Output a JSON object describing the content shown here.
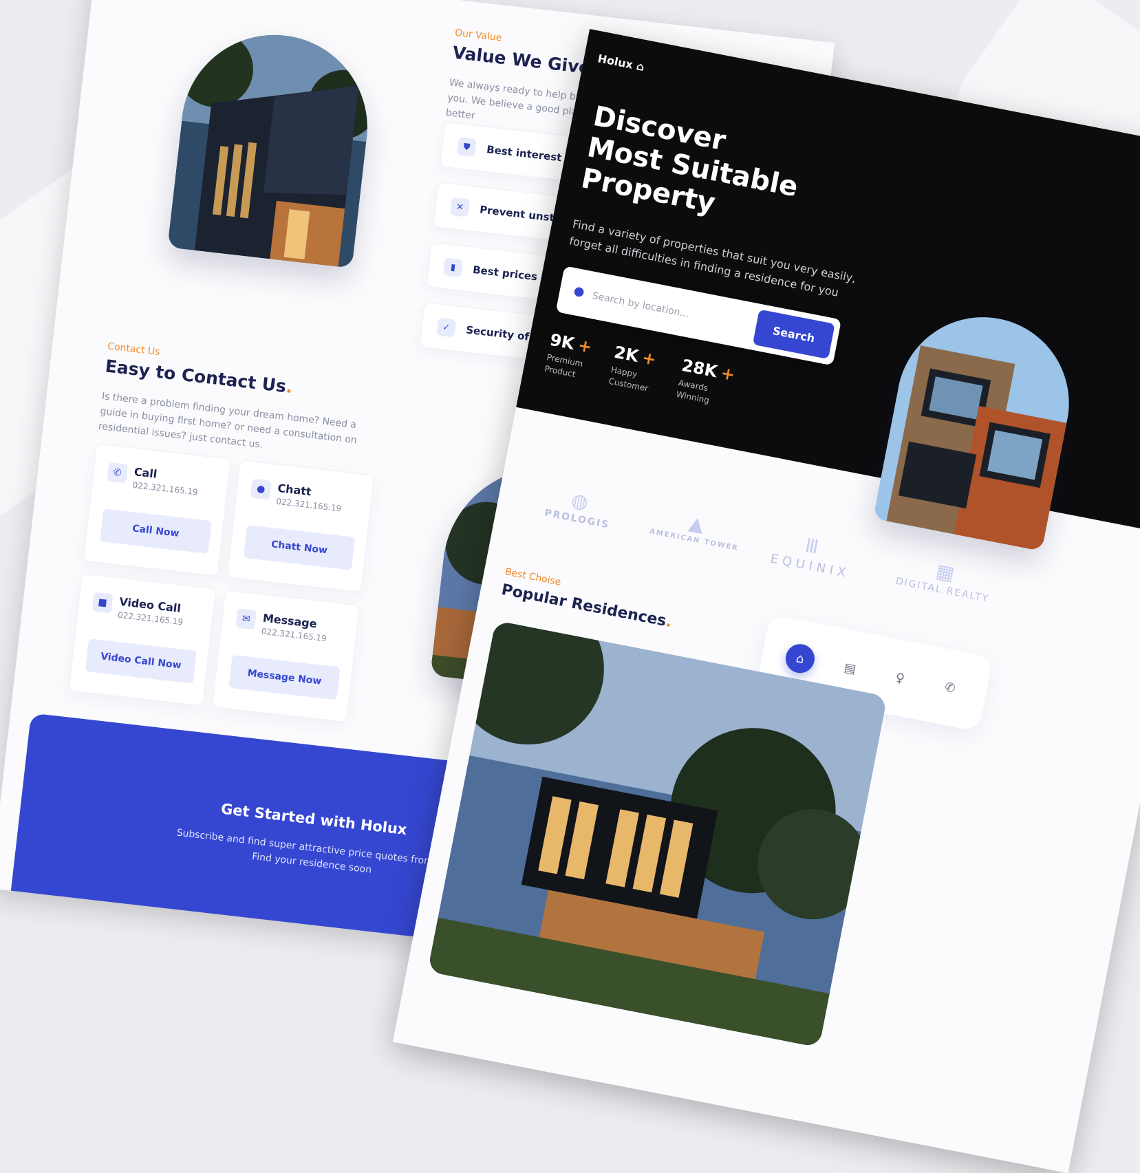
{
  "colors": {
    "accent": "#3547d1",
    "highlight": "#f08a2a",
    "dark": "#0c0c0d",
    "text": "#1c2350"
  },
  "value_section": {
    "eyebrow": "Our Value",
    "title": "Value We Give To You",
    "paragraph": "We always ready to help by providing the best service for you. We believe a good place to live can make your life better",
    "items": [
      {
        "icon": "shield-icon",
        "label": "Best interest rates on the market"
      },
      {
        "icon": "x-icon",
        "label": "Prevent unstable prices"
      },
      {
        "icon": "bar-chart-icon",
        "label": "Best prices on the market"
      },
      {
        "icon": "check-icon",
        "label": "Security of your data"
      }
    ]
  },
  "contact_section": {
    "eyebrow": "Contact Us",
    "title": "Easy to Contact Us",
    "title_dot": ".",
    "paragraph": "Is there a problem finding your dream home? Need a guide in buying first home? or need a consultation on residential issues? just contact us.",
    "cards": [
      {
        "icon": "phone-icon",
        "title": "Call",
        "number": "022.321.165.19",
        "button": "Call Now"
      },
      {
        "icon": "chat-icon",
        "title": "Chatt",
        "number": "022.321.165.19",
        "button": "Chatt Now"
      },
      {
        "icon": "video-icon",
        "title": "Video Call",
        "number": "022.321.165.19",
        "button": "Video Call Now"
      },
      {
        "icon": "mail-icon",
        "title": "Message",
        "number": "022.321.165.19",
        "button": "Message Now"
      }
    ]
  },
  "cta": {
    "title": "Get Started with Holux",
    "subtitle": "Subscribe and find super attractive price quotes from us. Find your residence soon"
  },
  "hero": {
    "logo": "Holux",
    "title_lines": [
      "Discover",
      "Most Suitable",
      "Property"
    ],
    "subtitle": "Find a variety of properties that suit you very easily, forget all difficulties in finding a residence for you",
    "search": {
      "placeholder": "Search by location...",
      "button": "Search"
    },
    "stats": [
      {
        "value": "9K",
        "plus": "+",
        "label": "Premium Product"
      },
      {
        "value": "2K",
        "plus": "+",
        "label": "Happy Customer"
      },
      {
        "value": "28K",
        "plus": "+",
        "label": "Awards Winning"
      }
    ]
  },
  "brands": [
    {
      "name": "PROLOGIS",
      "icon": "globe-icon"
    },
    {
      "name": "AMERICAN TOWER",
      "icon": "tower-icon"
    },
    {
      "name": "EQUINIX",
      "icon": "bars-icon"
    },
    {
      "name": "DIGITAL REALTY",
      "icon": "building-icon"
    }
  ],
  "popular": {
    "eyebrow": "Best Choise",
    "title": "Popular Residences",
    "title_dot": ".",
    "tabs": [
      {
        "icon": "home-icon",
        "active": true
      },
      {
        "icon": "apartment-icon",
        "active": false
      },
      {
        "icon": "bulb-icon",
        "active": false
      },
      {
        "icon": "phone-icon",
        "active": false
      }
    ]
  }
}
